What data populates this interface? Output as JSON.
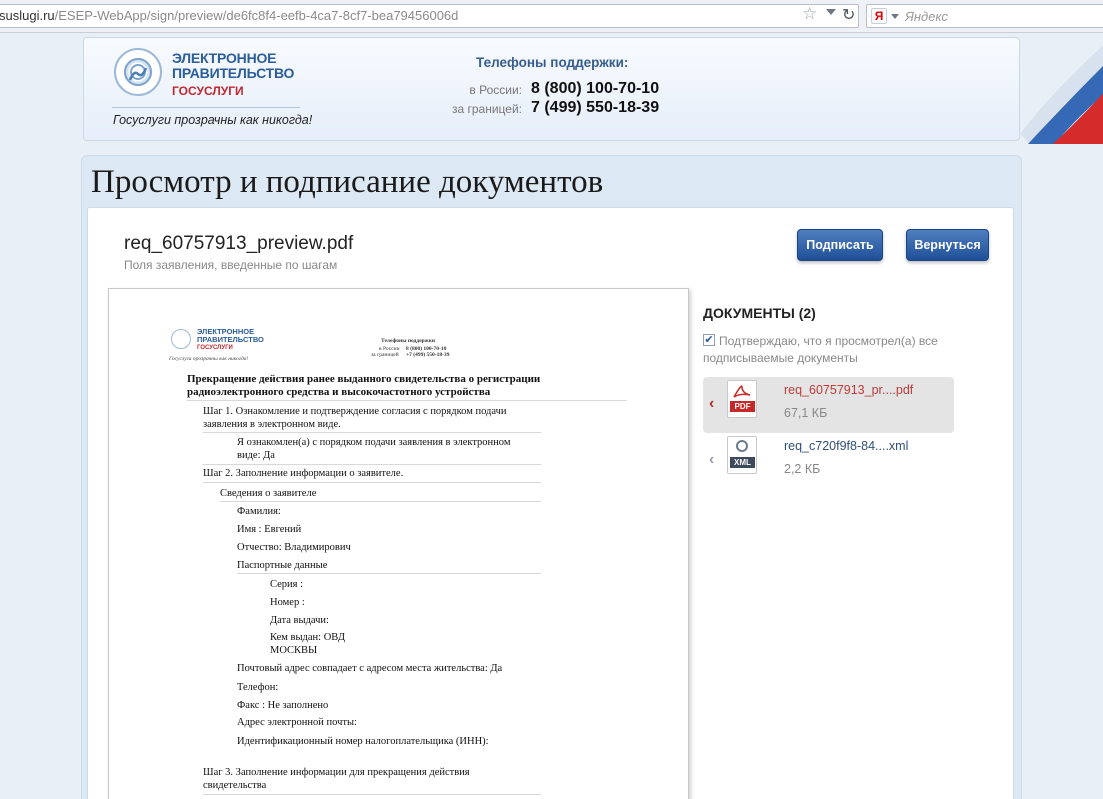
{
  "browser": {
    "url_host": "suslugi.ru",
    "url_path": "/ESEP-WebApp/sign/preview/de6fc8f4-eefb-4ca7-8cf7-bea79456006d",
    "search_engine_letter": "Я",
    "search_placeholder": "Яндекс"
  },
  "header": {
    "logo_line1": "ЭЛЕКТРОННОЕ",
    "logo_line2": "ПРАВИТЕЛЬСТВО",
    "logo_sub": "ГОСУСЛУГИ",
    "slogan": "Госуслуги прозрачны как никогда!",
    "phones_title": "Телефоны поддержки:",
    "phone_russia_label": "в России:",
    "phone_russia": "8 (800) 100-70-10",
    "phone_abroad_label": "за границей:",
    "phone_abroad": "7 (499) 550-18-39"
  },
  "page": {
    "title": "Просмотр и подписание документов",
    "file_title": "req_60757913_preview.pdf",
    "file_subtitle": "Поля заявления, введенные по шагам",
    "sign_button": "Подписать",
    "back_button": "Вернуться"
  },
  "preview": {
    "logo_line1": "ЭЛЕКТРОННОЕ",
    "logo_line2": "ПРАВИТЕЛЬСТВО",
    "logo_sub": "ГОСУСЛУГИ",
    "slogan": "Госуслуги прозрачны как никогда!",
    "phones_title": "Телефоны поддержки",
    "phone_russia_label": "в России",
    "phone_russia": "8 (800) 100-70-10",
    "phone_abroad_label": "за границей",
    "phone_abroad": "+7 (499) 550-18-39",
    "heading_line1": "Прекращение действия ранее выданного свидетельства о регистрации",
    "heading_line2": "радиоэлектронного средства и высокочастотного устройства",
    "step1_line1": "Шаг 1. Ознакомление и подтверждение согласия с порядком подачи",
    "step1_line2": "заявления в электронном виде.",
    "ack_line1": "Я ознакомлен(а) с порядком подачи заявления в электронном",
    "ack_line2": "виде: Да",
    "step2": "Шаг 2. Заполнение информации о заявителе.",
    "applicant_info": "Сведения о заявителе",
    "surname": "Фамилия:",
    "name": "Имя : Евгений",
    "patronymic": "Отчество: Владимирович",
    "passport": "Паспортные данные",
    "series": "Серия :",
    "number": "Номер :",
    "issue_date": "Дата выдачи:",
    "issued_by_line1": "Кем выдан: ОВД",
    "issued_by_line2": "МОСКВЫ",
    "postal_same": "Почтовый адрес совпадает с адресом места жительства: Да",
    "phone": "Телефон:",
    "fax": "Факс : Не заполнено",
    "email": "Адрес электронной почты:",
    "inn": "Идентификационный номер налогоплательщика (ИНН):",
    "step3_line1": "Шаг 3. Заполнение информации для прекращения действия",
    "step3_line2": "свидетельства"
  },
  "documents": {
    "title": "ДОКУМЕНТЫ (2)",
    "confirm_text": "Подтверждаю, что я просмотрел(а) все подписываемые документы",
    "checked": true,
    "items": [
      {
        "name": "req_60757913_pr....pdf",
        "size": "67,1 КБ",
        "type": "PDF",
        "icon": "pdf-file-icon",
        "active": true,
        "name_color": "#c03a3a",
        "tag_color": "#c62828"
      },
      {
        "name": "req_c720f9f8-84....xml",
        "size": "2,2 КБ",
        "type": "XML",
        "icon": "xml-file-icon",
        "active": false,
        "name_color": "#2f4f7a",
        "tag_color": "#3c4a5c"
      }
    ]
  },
  "colors": {
    "brand_blue": "#2b5d9a",
    "button_blue": "#2a5aa2",
    "brand_red": "#c2262e"
  }
}
